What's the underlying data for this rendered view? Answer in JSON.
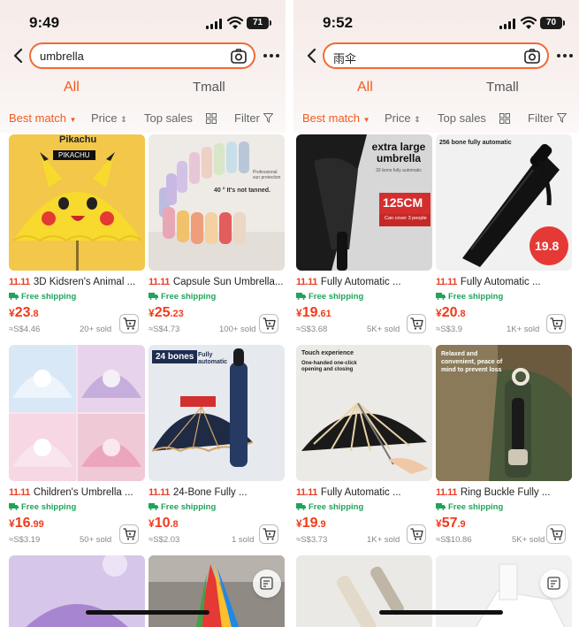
{
  "panels": [
    {
      "status": {
        "time": "9:49",
        "battery": "71"
      },
      "search": {
        "value": "umbrella"
      },
      "tabs": {
        "all": "All",
        "tmall": "Tmall"
      },
      "filters": {
        "best_match": "Best match",
        "price": "Price",
        "top_sales": "Top sales",
        "filter": "Filter"
      },
      "products": [
        {
          "badge": "11.11",
          "title": "3D Kidsren's Animal ...",
          "shipping": "Free shipping",
          "currency": "¥",
          "price_int": "23",
          "price_dec": ".8",
          "sgd": "≈S$4.46",
          "sold": "20+ sold",
          "image_text": [
            "Pikachu",
            "PIKACHU"
          ]
        },
        {
          "badge": "11.11",
          "title": "Capsule Sun Umbrella...",
          "shipping": "Free shipping",
          "currency": "¥",
          "price_int": "25",
          "price_dec": ".23",
          "sgd": "≈S$4.73",
          "sold": "100+ sold",
          "image_text": [
            "Professional sun protection",
            "40 ° It's not tanned."
          ]
        },
        {
          "badge": "11.11",
          "title": "Children's Umbrella ...",
          "shipping": "Free shipping",
          "currency": "¥",
          "price_int": "16",
          "price_dec": ".99",
          "sgd": "≈S$3.19",
          "sold": "50+ sold",
          "image_text": []
        },
        {
          "badge": "11.11",
          "title": "24-Bone Fully ...",
          "shipping": "Free shipping",
          "currency": "¥",
          "price_int": "10",
          "price_dec": ".8",
          "sgd": "≈S$2.03",
          "sold": "1 sold",
          "image_text": [
            "24 bones",
            "Fully automatic"
          ]
        }
      ]
    },
    {
      "status": {
        "time": "9:52",
        "battery": "70"
      },
      "search": {
        "value": "雨伞"
      },
      "tabs": {
        "all": "All",
        "tmall": "Tmall"
      },
      "filters": {
        "best_match": "Best match",
        "price": "Price",
        "top_sales": "Top sales",
        "filter": "Filter"
      },
      "products": [
        {
          "badge": "11.11",
          "title": "Fully Automatic ...",
          "shipping": "Free shipping",
          "currency": "¥",
          "price_int": "19",
          "price_dec": ".61",
          "sgd": "≈S$3.68",
          "sold": "5K+ sold",
          "image_text": [
            "extra large umbrella",
            "32-bone fully automatic",
            "125CM",
            "Can cover 3 people"
          ]
        },
        {
          "badge": "11.11",
          "title": "Fully Automatic ...",
          "shipping": "Free shipping",
          "currency": "¥",
          "price_int": "20",
          "price_dec": ".8",
          "sgd": "≈S$3.9",
          "sold": "1K+ sold",
          "image_text": [
            "256 bone fully automatic",
            "19.8"
          ]
        },
        {
          "badge": "11.11",
          "title": "Fully Automatic ...",
          "shipping": "Free shipping",
          "currency": "¥",
          "price_int": "19",
          "price_dec": ".9",
          "sgd": "≈S$3.73",
          "sold": "1K+ sold",
          "image_text": [
            "Touch experience",
            "One-handed one-click opening and closing"
          ]
        },
        {
          "badge": "11.11",
          "title": "Ring Buckle Fully ...",
          "shipping": "Free shipping",
          "currency": "¥",
          "price_int": "57",
          "price_dec": ".9",
          "sgd": "≈S$10.86",
          "sold": "5K+ sold",
          "image_text": [
            "Relaxed and convenient, peace of mind to prevent loss"
          ]
        }
      ]
    }
  ],
  "colors": {
    "accent": "#f35a1f",
    "price": "#f23a1a",
    "shipping": "#1fa45b",
    "search_border": "#f06a37"
  },
  "icons": [
    "back-arrow-icon",
    "camera-icon",
    "more-icon",
    "sort-arrows-icon",
    "grid-view-icon",
    "filter-icon",
    "truck-icon",
    "cart-icon",
    "edit-icon"
  ]
}
